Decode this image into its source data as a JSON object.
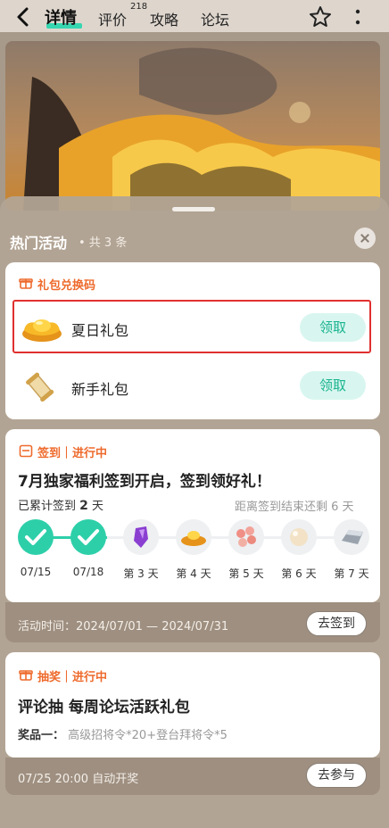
{
  "topbar": {
    "tabs": [
      {
        "label": "详情"
      },
      {
        "label": "评价",
        "sup": "218"
      },
      {
        "label": "攻略"
      },
      {
        "label": "论坛"
      }
    ]
  },
  "sheet": {
    "title": "热门活动",
    "count": "• 共 3 条"
  },
  "gift_section": {
    "label": "礼包兑换码",
    "items": [
      {
        "name": "夏日礼包",
        "action": "领取",
        "icon": "gold-ingot-icon"
      },
      {
        "name": "新手礼包",
        "action": "领取",
        "icon": "scroll-icon"
      }
    ]
  },
  "signin_section": {
    "label": "签到｜进行中",
    "title": "7月独家福利签到开启，签到领好礼！",
    "accum_prefix": "已累计签到",
    "accum_days": "2",
    "accum_suffix": "天",
    "remaining": "距离签到结束还剩 6 天",
    "days": [
      {
        "label": "07/15",
        "done": true,
        "icon": "check-icon"
      },
      {
        "label": "07/18",
        "done": true,
        "icon": "check-icon"
      },
      {
        "label": "第 3 天",
        "done": false,
        "icon": "purple-gem-icon"
      },
      {
        "label": "第 4 天",
        "done": false,
        "icon": "gold-ingot-icon"
      },
      {
        "label": "第 5 天",
        "done": false,
        "icon": "coral-icon"
      },
      {
        "label": "第 6 天",
        "done": false,
        "icon": "pearl-icon"
      },
      {
        "label": "第 7 天",
        "done": false,
        "icon": "silver-bar-icon"
      }
    ],
    "period": "活动时间：2024/07/01 — 2024/07/31",
    "action": "去签到"
  },
  "lottery_section": {
    "label": "抽奖｜进行中",
    "title": "评论抽 每周论坛活跃礼包",
    "prize_label": "奖品一：",
    "prize": "高级招将令*20+登台拜将令*5",
    "draw_time": "07/25 20:00 自动开奖",
    "action": "去参与"
  },
  "colors": {
    "accent": "#2dcfa9",
    "section_label": "#ee6a2c",
    "highlight_border": "#e0302f"
  }
}
